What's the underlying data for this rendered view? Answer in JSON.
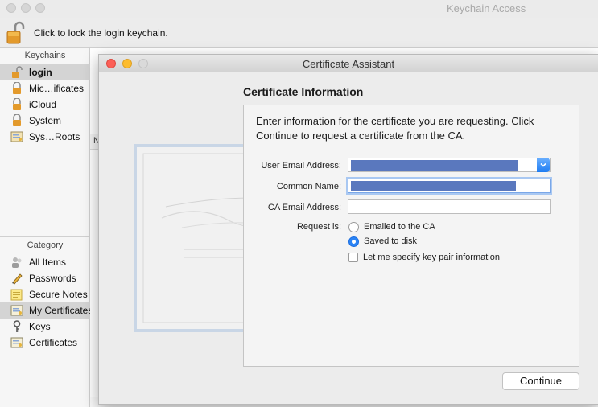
{
  "app": {
    "title": "Keychain Access"
  },
  "toolbar": {
    "lock_label": "Click to lock the login keychain."
  },
  "sidebar": {
    "keychains_header": "Keychains",
    "keychains": [
      {
        "label": "login",
        "icon": "lock-open-icon",
        "selected": true
      },
      {
        "label": "Mic…ificates",
        "icon": "lock-icon"
      },
      {
        "label": "iCloud",
        "icon": "lock-icon"
      },
      {
        "label": "System",
        "icon": "lock-icon"
      },
      {
        "label": "Sys…Roots",
        "icon": "cert-folder-icon"
      }
    ],
    "category_header": "Category",
    "categories": [
      {
        "label": "All Items",
        "icon": "people-icon"
      },
      {
        "label": "Passwords",
        "icon": "pencil-icon"
      },
      {
        "label": "Secure Notes",
        "icon": "note-icon"
      },
      {
        "label": "My Certificates",
        "icon": "certificate-icon",
        "selected": true
      },
      {
        "label": "Keys",
        "icon": "key-icon"
      },
      {
        "label": "Certificates",
        "icon": "certificate-icon"
      }
    ]
  },
  "list": {
    "column_header": "N"
  },
  "dialog": {
    "title": "Certificate Assistant",
    "section_title": "Certificate Information",
    "instructions": "Enter information for the certificate you are requesting. Click Continue to request a certificate from the CA.",
    "fields": {
      "user_email_label": "User Email Address:",
      "common_name_label": "Common Name:",
      "ca_email_label": "CA Email Address:",
      "ca_email_value": ""
    },
    "request_label": "Request is:",
    "request_options": [
      {
        "label": "Emailed to the CA",
        "selected": false
      },
      {
        "label": "Saved to disk",
        "selected": true
      }
    ],
    "key_pair_checkbox": {
      "label": "Let me specify key pair information",
      "checked": false
    },
    "continue_label": "Continue"
  },
  "colors": {
    "accent": "#2a83f5",
    "close": "#fc5f57",
    "minimize": "#fdbc2e"
  }
}
